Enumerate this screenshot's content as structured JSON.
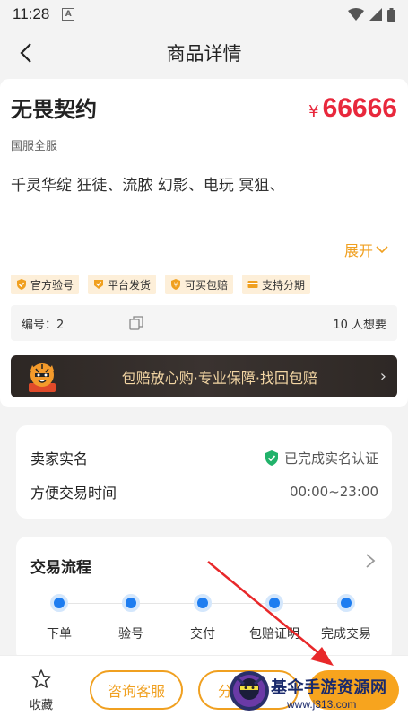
{
  "status": {
    "time": "11:28"
  },
  "nav": {
    "title": "商品详情"
  },
  "product": {
    "title": "无畏契约",
    "currency": "¥",
    "price": "66666",
    "server": "国服全服",
    "description": "千灵华绽 狂徒、流脓 幻影、电玩 冥狙、",
    "expand_label": "展开",
    "tags": [
      "官方验号",
      "平台发货",
      "可买包赔",
      "支持分期"
    ],
    "id_label": "编号：2",
    "wants": "10 人想要",
    "banner_text": "包赔放心购·专业保障·找回包赔"
  },
  "seller": {
    "realname_label": "卖家实名",
    "realname_value": "已完成实名认证",
    "time_label": "方便交易时间",
    "time_value": "00:00~23:00"
  },
  "flow": {
    "title": "交易流程",
    "steps": [
      "下单",
      "验号",
      "交付",
      "包赔证明",
      "完成交易"
    ]
  },
  "bottom": {
    "fav_label": "收藏",
    "consult_label": "咨询客服",
    "second_label": "分"
  },
  "watermark": {
    "text": "基伞手游资源网",
    "url": "www.j313.com"
  },
  "colors": {
    "accent": "#f0a020",
    "price": "#e8283c",
    "step": "#1e7df0"
  }
}
